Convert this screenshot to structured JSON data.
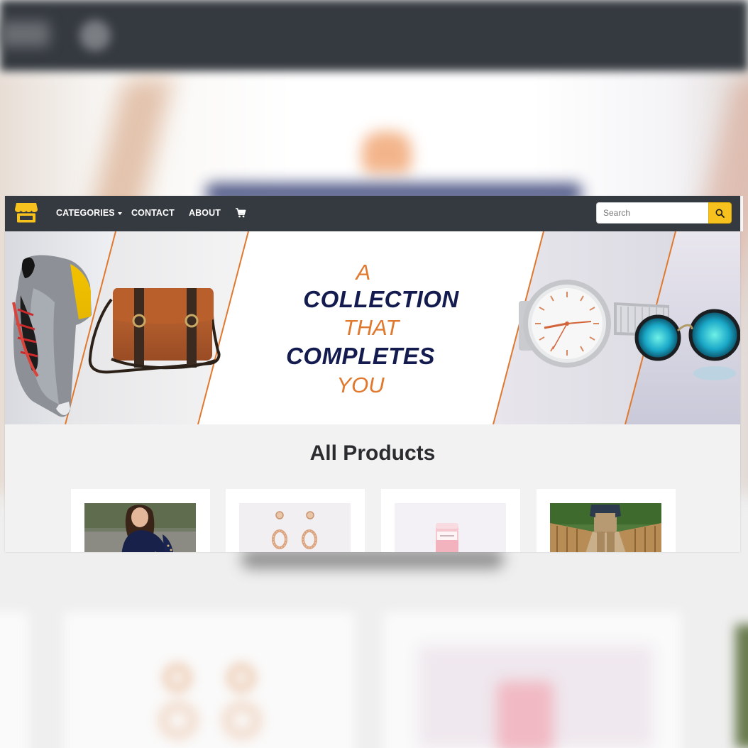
{
  "navbar": {
    "logo_icon": "store-icon",
    "links": {
      "categories": "CATEGORIES",
      "contact": "CONTACT",
      "about": "ABOUT"
    },
    "cart_icon": "cart-icon",
    "search": {
      "placeholder": "Search",
      "value": "",
      "button_icon": "search-icon"
    }
  },
  "hero": {
    "line1": "A",
    "line2": "COLLECTION",
    "line3": "THAT",
    "line4": "COMPLETES",
    "line5": "YOU"
  },
  "section": {
    "title": "All Products"
  },
  "products": [
    {
      "image": "woman-in-navy-top"
    },
    {
      "image": "rose-gold-earrings"
    },
    {
      "image": "rose-lotion-tube"
    },
    {
      "image": "man-on-bridge"
    }
  ],
  "colors": {
    "navbar_bg": "#353a40",
    "accent_yellow": "#f7c21d",
    "hero_orange": "#e0782e",
    "hero_navy": "#131b4f",
    "page_bg": "#f2f2f2"
  }
}
